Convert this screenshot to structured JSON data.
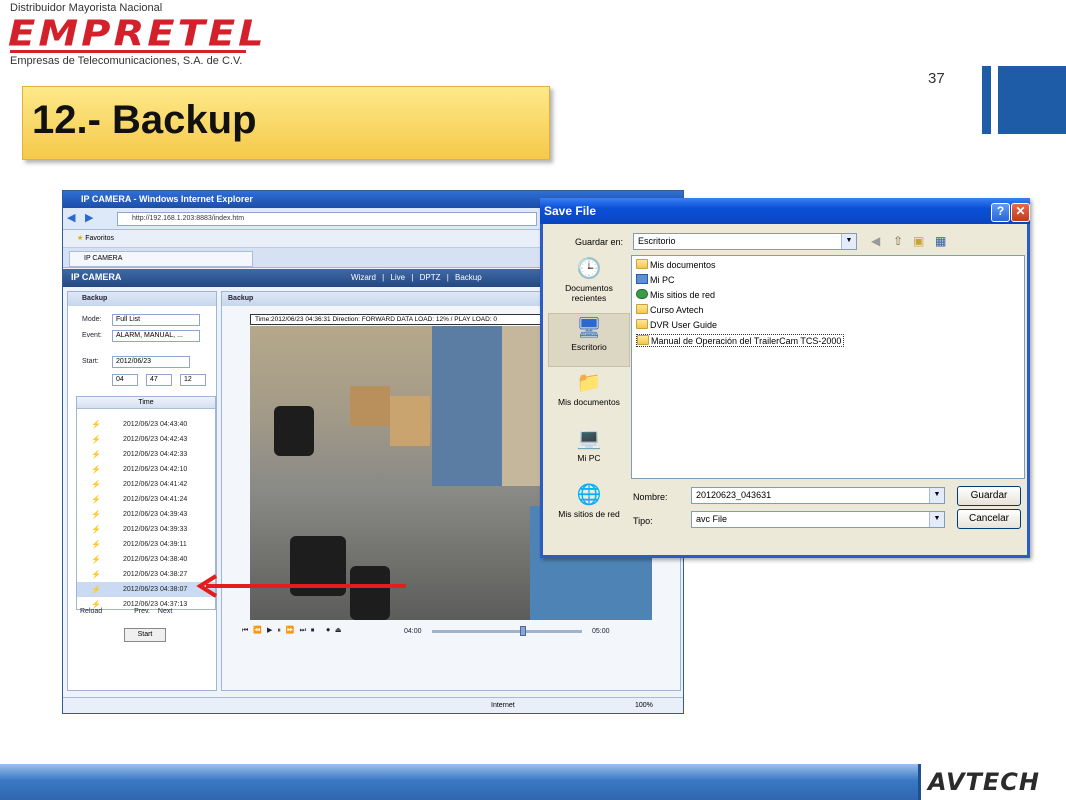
{
  "header": {
    "logo_top": "Distribuidor Mayorista Nacional",
    "logo_main": "EMPRETEL",
    "logo_sub": "Empresas de Telecomunicaciones, S.A. de C.V.",
    "page_number": "37",
    "title": "12.- Backup"
  },
  "browser": {
    "window_title": "IP CAMERA - Windows Internet Explorer",
    "url": "http://192.168.1.203:8883/index.htm",
    "favorites": "Favoritos",
    "tab_label": "IP CAMERA",
    "brand": "IP CAMERA",
    "nav_links": "Wizard | Live | DPTZ | Backup",
    "status_internet": "Internet",
    "status_zoom": "100%"
  },
  "side_panel": {
    "header": "Backup",
    "mode_label": "Mode:",
    "mode_value": "Full List",
    "event_label": "Event:",
    "event_value": "ALARM, MANUAL, ...",
    "start_label": "Start:",
    "start_date": "2012/06/23",
    "hour": "04",
    "minute": "47",
    "second": "12",
    "list_header": "Time",
    "times": [
      "2012/06/23 04:43:40",
      "2012/06/23 04:42:43",
      "2012/06/23 04:42:33",
      "2012/06/23 04:42:10",
      "2012/06/23 04:41:42",
      "2012/06/23 04:41:24",
      "2012/06/23 04:39:43",
      "2012/06/23 04:39:33",
      "2012/06/23 04:39:11",
      "2012/06/23 04:38:40",
      "2012/06/23 04:38:27",
      "2012/06/23 04:38:07",
      "2012/06/23 04:37:13"
    ],
    "reload": "Reload",
    "prev": "Prev.",
    "next": "Next",
    "start_button": "Start"
  },
  "main_panel": {
    "header": "Backup",
    "overlay": "Time:2012/06/23 04:36:31   Direction: FORWARD  DATA LOAD: 12% / PLAY LOAD: 0",
    "time_start": "04:00",
    "time_end": "05:00"
  },
  "save_dialog": {
    "title": "Save File",
    "save_in_label": "Guardar en:",
    "save_in_value": "Escritorio",
    "places": [
      "Documentos recientes",
      "Escritorio",
      "Mis documentos",
      "Mi PC",
      "Mis sitios de red"
    ],
    "files": [
      "Mis documentos",
      "Mi PC",
      "Mis sitios de red",
      "Curso Avtech",
      "DVR User Guide",
      "Manual de Operación del TrailerCam TCS-2000"
    ],
    "name_label": "Nombre:",
    "name_value": "20120623_043631",
    "type_label": "Tipo:",
    "type_value": "avc File",
    "save_button": "Guardar",
    "cancel_button": "Cancelar"
  },
  "footer": {
    "brand": "AVTECH"
  },
  "colors": {
    "accent_blue": "#1f5ca8",
    "brand_red": "#d4202a",
    "title_yellow": "#f5c94a",
    "arrow_red": "#e41c1c"
  }
}
